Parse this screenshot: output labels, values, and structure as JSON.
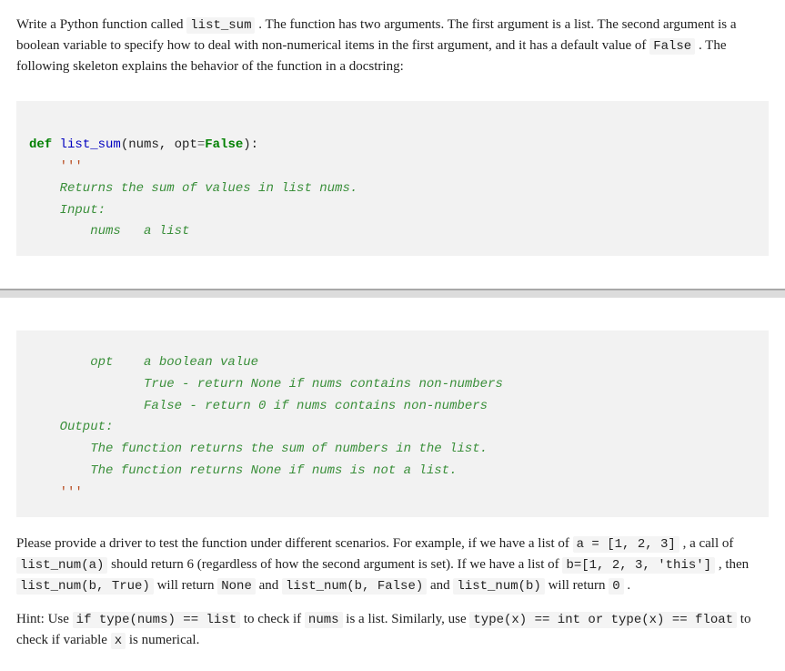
{
  "intro": {
    "t1": "Write a Python function called ",
    "c1": "list_sum",
    "t2": " . The function has two arguments. The first argument is a list. The second argument is a boolean variable to specify how to deal with non-numerical items in the first argument, and it has a default value of ",
    "c2": "False",
    "t3": " . The following skeleton explains the behavior of the function in a docstring:"
  },
  "code_top": {
    "kw_def": "def",
    "fn": "list_sum",
    "sig_open": "(nums, opt",
    "eq": "=",
    "false": "False",
    "sig_close": "):",
    "q1": "    '''",
    "d1": "    Returns the sum of values in list nums.",
    "d2": "    Input:",
    "d3": "        nums   a list"
  },
  "code_bot": {
    "d4": "        opt    a boolean value",
    "d5": "               True - return None if nums contains non-numbers",
    "d6": "               False - return 0 if nums contains non-numbers",
    "d7": "    Output:",
    "d8": "        The function returns the sum of numbers in the list.",
    "d9": "        The function returns None if nums is not a list.",
    "q2": "    '''"
  },
  "driver": {
    "t1": "Please provide a driver to test the function under different scenarios. For example, if we have a list of ",
    "c1": "a = [1, 2, 3]",
    "t2": " , a call of ",
    "c2": "list_num(a)",
    "t3": " should return 6 (regardless of how the second argument is set). If we have a list of ",
    "c3": "b=[1, 2, 3, 'this']",
    "t4": " , then ",
    "c4": "list_num(b, True)",
    "t5": " will return ",
    "c5": "None",
    "t6": " and ",
    "c6": "list_num(b, False)",
    "t7": " and ",
    "c7": "list_num(b)",
    "t8": " will return ",
    "c8": "0",
    "t9": " ."
  },
  "hint": {
    "t1": "Hint: Use ",
    "c1": "if type(nums) == list",
    "t2": " to check if ",
    "c2": "nums",
    "t3": " is a list. Similarly, use ",
    "c3": "type(x) == int or type(x) == float",
    "t4": " to check if variable ",
    "c4": "x",
    "t5": " is numerical."
  }
}
